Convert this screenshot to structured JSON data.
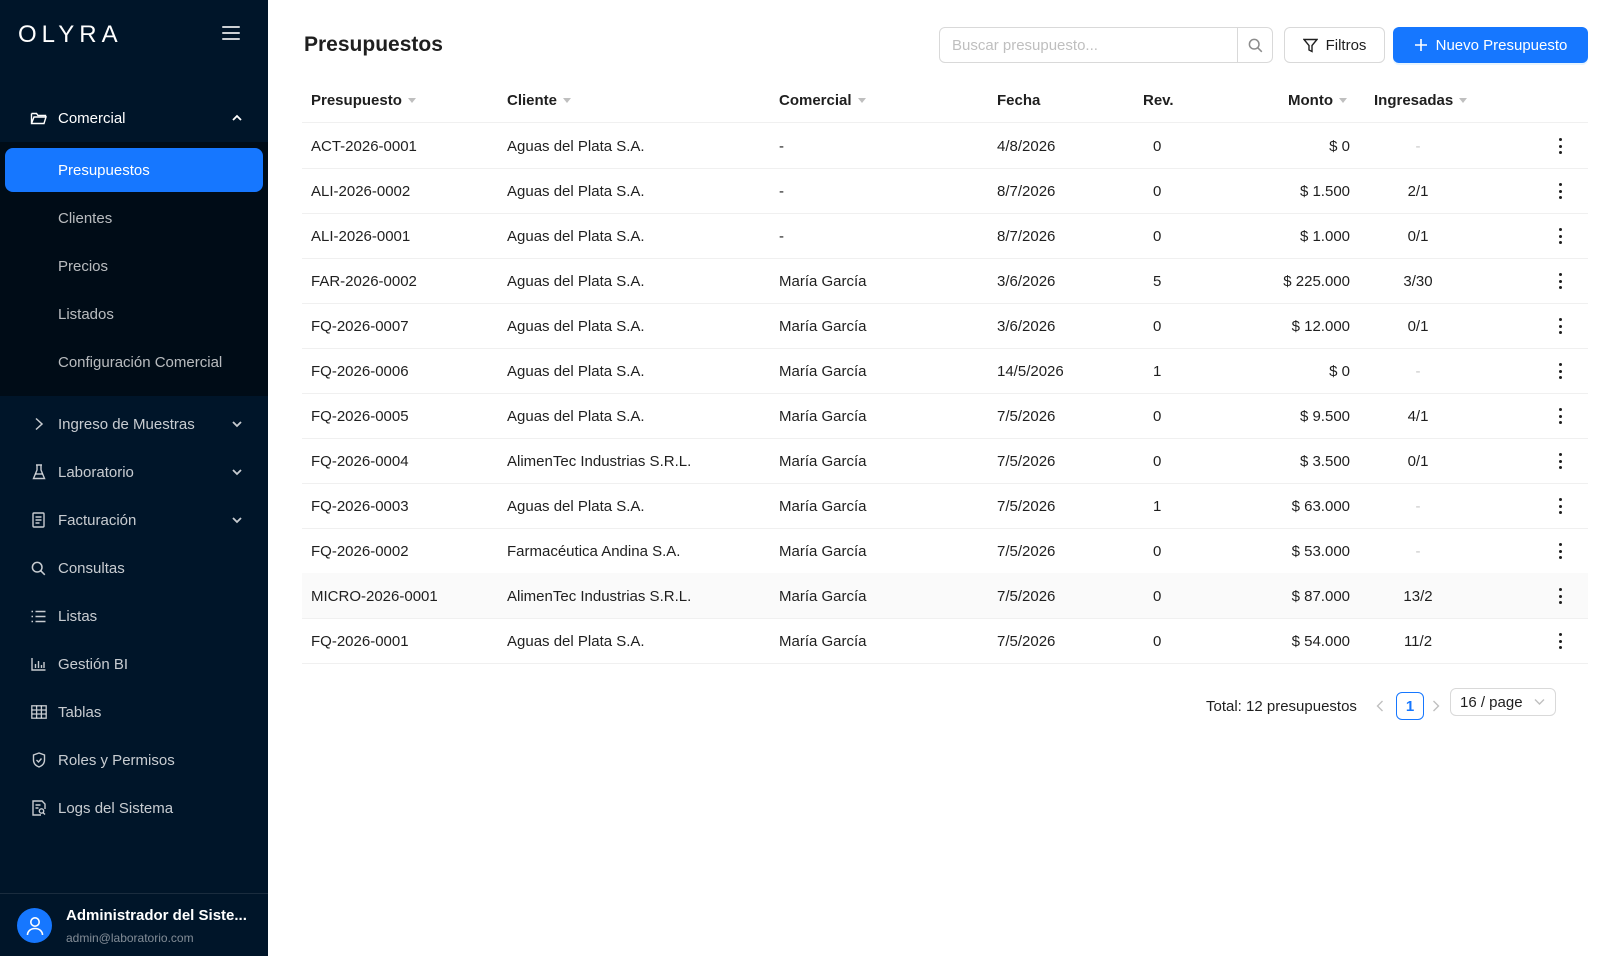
{
  "brand": {
    "name": "OLYRA"
  },
  "colors": {
    "sidebar": "#001529",
    "submenu": "#000c17",
    "accent": "#1677ff"
  },
  "sidebar": {
    "sections": [
      {
        "label": "Comercial",
        "icon": "folder-open-icon",
        "open": true
      },
      {
        "label": "Ingreso de Muestras",
        "icon": "chevron-right-icon"
      },
      {
        "label": "Laboratorio",
        "icon": "flask-icon"
      },
      {
        "label": "Facturación",
        "icon": "receipt-icon"
      },
      {
        "label": "Consultas",
        "icon": "search-icon"
      },
      {
        "label": "Listas",
        "icon": "list-icon"
      },
      {
        "label": "Gestión BI",
        "icon": "bar-chart-icon"
      },
      {
        "label": "Tablas",
        "icon": "table-icon"
      },
      {
        "label": "Roles y Permisos",
        "icon": "shield-icon"
      },
      {
        "label": "Logs del Sistema",
        "icon": "file-search-icon"
      }
    ],
    "comercial_items": [
      {
        "label": "Presupuestos",
        "active": true
      },
      {
        "label": "Clientes"
      },
      {
        "label": "Precios"
      },
      {
        "label": "Listados"
      },
      {
        "label": "Configuración Comercial"
      }
    ],
    "user": {
      "name": "Administrador del Siste...",
      "email": "admin@laboratorio.com"
    }
  },
  "header": {
    "title": "Presupuestos",
    "search_placeholder": "Buscar presupuesto...",
    "filter_label": "Filtros",
    "new_label": "Nuevo Presupuesto"
  },
  "table": {
    "columns": [
      "Presupuesto",
      "Cliente",
      "Comercial",
      "Fecha",
      "Rev.",
      "Monto",
      "Ingresadas"
    ],
    "rows": [
      {
        "id": "ACT-2026-0001",
        "cliente": "Aguas del Plata S.A.",
        "comercial": "-",
        "fecha": "4/8/2026",
        "rev": "0",
        "monto": "$ 0",
        "ingresadas": "-"
      },
      {
        "id": "ALI-2026-0002",
        "cliente": "Aguas del Plata S.A.",
        "comercial": "-",
        "fecha": "8/7/2026",
        "rev": "0",
        "monto": "$ 1.500",
        "ingresadas": "2/1"
      },
      {
        "id": "ALI-2026-0001",
        "cliente": "Aguas del Plata S.A.",
        "comercial": "-",
        "fecha": "8/7/2026",
        "rev": "0",
        "monto": "$ 1.000",
        "ingresadas": "0/1"
      },
      {
        "id": "FAR-2026-0002",
        "cliente": "Aguas del Plata S.A.",
        "comercial": "María García",
        "fecha": "3/6/2026",
        "rev": "5",
        "monto": "$ 225.000",
        "ingresadas": "3/30"
      },
      {
        "id": "FQ-2026-0007",
        "cliente": "Aguas del Plata S.A.",
        "comercial": "María García",
        "fecha": "3/6/2026",
        "rev": "0",
        "monto": "$ 12.000",
        "ingresadas": "0/1"
      },
      {
        "id": "FQ-2026-0006",
        "cliente": "Aguas del Plata S.A.",
        "comercial": "María García",
        "fecha": "14/5/2026",
        "rev": "1",
        "monto": "$ 0",
        "ingresadas": "-"
      },
      {
        "id": "FQ-2026-0005",
        "cliente": "Aguas del Plata S.A.",
        "comercial": "María García",
        "fecha": "7/5/2026",
        "rev": "0",
        "monto": "$ 9.500",
        "ingresadas": "4/1"
      },
      {
        "id": "FQ-2026-0004",
        "cliente": "AlimenTec Industrias S.R.L.",
        "comercial": "María García",
        "fecha": "7/5/2026",
        "rev": "0",
        "monto": "$ 3.500",
        "ingresadas": "0/1"
      },
      {
        "id": "FQ-2026-0003",
        "cliente": "Aguas del Plata S.A.",
        "comercial": "María García",
        "fecha": "7/5/2026",
        "rev": "1",
        "monto": "$ 63.000",
        "ingresadas": "-"
      },
      {
        "id": "FQ-2026-0002",
        "cliente": "Farmacéutica Andina S.A.",
        "comercial": "María García",
        "fecha": "7/5/2026",
        "rev": "0",
        "monto": "$ 53.000",
        "ingresadas": "-"
      },
      {
        "id": "MICRO-2026-0001",
        "cliente": "AlimenTec Industrias S.R.L.",
        "comercial": "María García",
        "fecha": "7/5/2026",
        "rev": "0",
        "monto": "$ 87.000",
        "ingresadas": "13/2"
      },
      {
        "id": "FQ-2026-0001",
        "cliente": "Aguas del Plata S.A.",
        "comercial": "María García",
        "fecha": "7/5/2026",
        "rev": "0",
        "monto": "$ 54.000",
        "ingresadas": "11/2"
      }
    ]
  },
  "pagination": {
    "total": "Total: 12 presupuestos",
    "current": "1",
    "page_size": "16 / page"
  }
}
